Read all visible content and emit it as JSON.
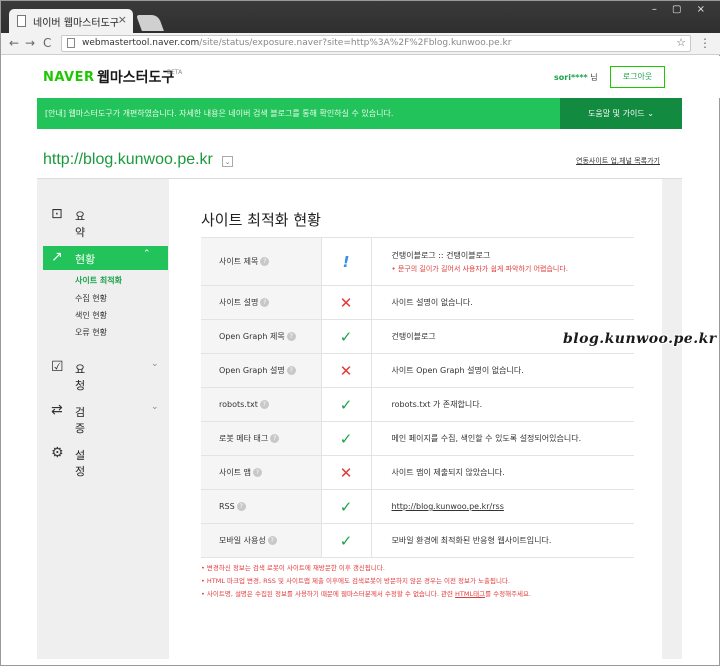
{
  "browser": {
    "tab_title": "네이버 웹마스터도구",
    "tab_close": "×",
    "window_controls": "– ▢ ×",
    "url_host": "webmastertool.naver.com",
    "url_rest": "/site/status/exposure.naver?site=http%3A%2F%2Fblog.kunwoo.pe.kr",
    "back_icon": "←",
    "forward_icon": "→",
    "reload_icon": "C",
    "star_icon": "☆",
    "menu_icon": "⋮"
  },
  "header": {
    "logo": "NAVER",
    "product": "웹마스터도구",
    "beta": "BETA",
    "user_name": "sori****",
    "user_suffix": " 님",
    "logout": "로그아웃"
  },
  "notice": {
    "text": "[안내] 웹마스터도구가 개편하였습니다. 자세한 내용은 네이버 검색 블로그를 통해 확인하실 수 있습니다.",
    "help": "도움말 및 가이드  ⌄"
  },
  "site": {
    "url": "http://blog.kunwoo.pe.kr",
    "dropdown": "⌄",
    "site_list_link": "연동사이트 업,체널 목록가기"
  },
  "sidebar": {
    "summary": {
      "label": "요약",
      "icon": "⊡"
    },
    "status": {
      "label": "현황",
      "icon": "↗",
      "chevron": "⌃"
    },
    "status_sub": [
      "사이트 최적화",
      "수집 현황",
      "색인 현황",
      "오류 현황"
    ],
    "request": {
      "label": "요청",
      "icon": "☑",
      "chevron": "⌄"
    },
    "verify": {
      "label": "검증",
      "icon": "⇄",
      "chevron": "⌄"
    },
    "settings": {
      "label": "설정",
      "icon": "⚙"
    }
  },
  "content": {
    "title": "사이트 최적화 현황",
    "rows": [
      {
        "label": "사이트 제목",
        "status": "!",
        "value": "건탱이블로그 :: 건탱이블로그",
        "warning": "• 문구의 길이가 길어서 사용자가 쉽게 파악하기 어렵습니다."
      },
      {
        "label": "사이트 설명",
        "status": "✕",
        "value": "사이트 설명이 없습니다."
      },
      {
        "label": "Open Graph 제목",
        "status": "✓",
        "value": "건탱이블로그"
      },
      {
        "label": "Open Graph 설명",
        "status": "✕",
        "value": "사이트 Open Graph 설명이 없습니다."
      },
      {
        "label": "robots.txt",
        "status": "✓",
        "value": "robots.txt 가 존재합니다."
      },
      {
        "label": "로봇 메타 태그",
        "status": "✓",
        "value": "메인 페이지를 수집, 색인할 수 있도록 설정되어있습니다."
      },
      {
        "label": "사이트 맵",
        "status": "✕",
        "value": "사이트 맵이 제출되지 않았습니다."
      },
      {
        "label": "RSS",
        "status": "✓",
        "value": "http://blog.kunwoo.pe.kr/rss"
      },
      {
        "label": "모바일 사용성",
        "status": "✓",
        "value": "모바일 환경에 최적화된 반응형 웹사이트입니다."
      }
    ],
    "help_mark": "?",
    "notes": [
      "• 변경하신 정보는 검색 로봇이 사이트에 재방문한 이후 갱신됩니다.",
      "• HTML 마크업 변경, RSS 및 사이트맵 제출 이후에도 검색로봇이 방문하지 않은 경우는 이전 정보가 노출됩니다.",
      "• 사이트명, 설명은 수집된 정보를 사용하기 때문에 웹마스터분께서 수정할 수 없습니다. 관련 ",
      "HTML태그",
      "를 수정해주세요."
    ]
  },
  "watermark": "blog.kunwoo.pe.kr"
}
